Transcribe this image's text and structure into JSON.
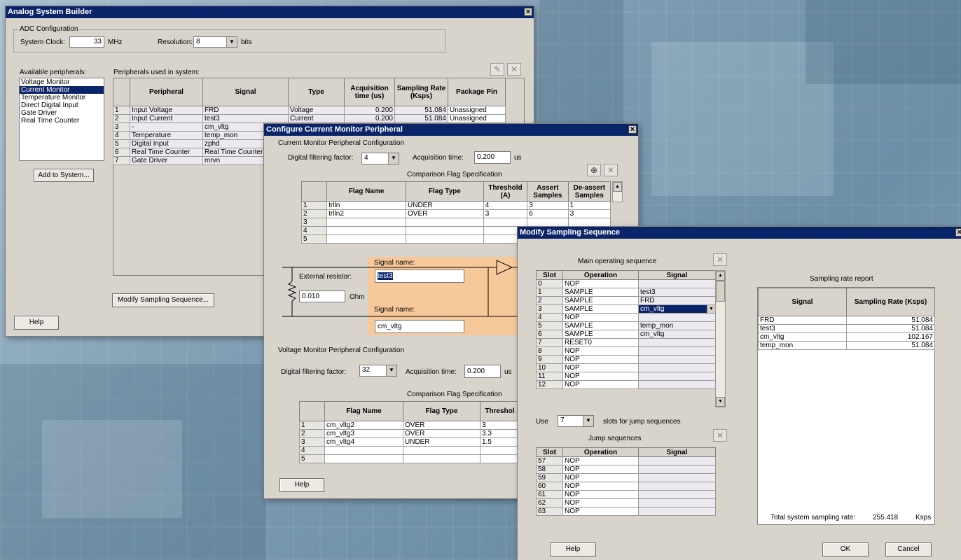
{
  "asb": {
    "title": "Analog System Builder",
    "adc_group": "ADC Configuration",
    "system_clock_label": "System Clock:",
    "system_clock_value": "33",
    "mhz": "MHz",
    "resolution_label": "Resolution:",
    "resolution_value": "8",
    "bits": "bits",
    "available_label": "Available peripherals:",
    "available": [
      "Voltage Monitor",
      "Current Monitor",
      "Temperature Monitor",
      "Direct Digital Input",
      "Gate Driver",
      "Real Time Counter"
    ],
    "used_label": "Peripherals used in system:",
    "headers": [
      "Peripheral",
      "Signal",
      "Type",
      "Acquisition time (us)",
      "Sampling Rate (Ksps)",
      "Package Pin"
    ],
    "rows": [
      [
        "1",
        "Input Voltage",
        "FRD",
        "Voltage",
        "0.200",
        "51.084",
        "Unassigned"
      ],
      [
        "2",
        "Input Current",
        "test3",
        "Current",
        "0.200",
        "51.084",
        "Unassigned"
      ],
      [
        "3",
        "-",
        "cm_vltg",
        "",
        "",
        "",
        ""
      ],
      [
        "4",
        "Temperature",
        "temp_mon",
        "",
        "",
        "",
        ""
      ],
      [
        "5",
        "Digital Input",
        "zphd",
        "",
        "",
        "",
        ""
      ],
      [
        "6",
        "Real Time Counter",
        "Real Time Counter",
        "",
        "",
        "",
        ""
      ],
      [
        "7",
        "Gate Driver",
        "mrvn",
        "",
        "",
        "",
        ""
      ]
    ],
    "add_button": "Add to System...",
    "modify_button": "Modify Sampling Sequence...",
    "help_button": "Help"
  },
  "ccm": {
    "title": "Configure Current Monitor Peripheral",
    "section1": "Current Monitor Peripheral Configuration",
    "dff_label": "Digital filtering factor:",
    "dff_value": "4",
    "acq_label": "Acquisition time:",
    "acq_value": "0.200",
    "us": "us",
    "cfs_label": "Comparison Flag Specification",
    "flag_headers": [
      "Flag Name",
      "Flag Type",
      "Threshold (A)",
      "Assert Samples",
      "De-assert Samples"
    ],
    "flags": [
      [
        "1",
        "trlln",
        "UNDER",
        "4",
        "3",
        "1"
      ],
      [
        "2",
        "trlln2",
        "OVER",
        "3",
        "6",
        "3"
      ],
      [
        "3",
        "",
        "",
        "",
        "",
        ""
      ],
      [
        "4",
        "",
        "",
        "",
        "",
        ""
      ],
      [
        "5",
        "",
        "",
        "",
        "",
        ""
      ]
    ],
    "ext_res_label": "External resistor:",
    "ext_res_value": "0.010",
    "ohm": "Ohm",
    "signal_name_label": "Signal name:",
    "signal1_value": "test3",
    "signal2_label": "Signal name:",
    "signal2_value": "cm_vltg",
    "section2": "Voltage Monitor Peripheral Configuration",
    "dff2_label": "Digital filtering factor:",
    "dff2_value": "32",
    "acq2_label": "Acquisition time:",
    "acq2_value": "0.200",
    "us2": "us",
    "cfs2_label": "Comparison Flag Specification",
    "vflag_headers": [
      "Flag Name",
      "Flag Type",
      "Threshol (V)"
    ],
    "vflags": [
      [
        "1",
        "cm_vltg2",
        "OVER",
        "3"
      ],
      [
        "2",
        "cm_vltg3",
        "OVER",
        "3.3"
      ],
      [
        "3",
        "cm_vltg4",
        "UNDER",
        "1.5"
      ],
      [
        "4",
        "",
        "",
        ""
      ],
      [
        "5",
        "",
        "",
        ""
      ]
    ],
    "help_button": "Help"
  },
  "mss": {
    "title": "Modify Sampling Sequence",
    "main_label": "Main operating sequence",
    "seq_headers": [
      "Slot",
      "Operation",
      "Signal"
    ],
    "main_rows": [
      [
        "0",
        "NOP",
        ""
      ],
      [
        "1",
        "SAMPLE",
        "test3"
      ],
      [
        "2",
        "SAMPLE",
        "FRD"
      ],
      [
        "3",
        "SAMPLE",
        "cm_vltg"
      ],
      [
        "4",
        "NOP",
        ""
      ],
      [
        "5",
        "SAMPLE",
        "temp_mon"
      ],
      [
        "6",
        "SAMPLE",
        "cm_vltg"
      ],
      [
        "7",
        "RESET0",
        ""
      ],
      [
        "8",
        "NOP",
        ""
      ],
      [
        "9",
        "NOP",
        ""
      ],
      [
        "10",
        "NOP",
        ""
      ],
      [
        "11",
        "NOP",
        ""
      ],
      [
        "12",
        "NOP",
        ""
      ]
    ],
    "use_label": "Use",
    "use_value": "7",
    "slots_label": "slots for jump sequences",
    "jump_label": "Jump sequences",
    "jump_rows": [
      [
        "57",
        "NOP",
        ""
      ],
      [
        "58",
        "NOP",
        ""
      ],
      [
        "59",
        "NOP",
        ""
      ],
      [
        "60",
        "NOP",
        ""
      ],
      [
        "61",
        "NOP",
        ""
      ],
      [
        "62",
        "NOP",
        ""
      ],
      [
        "63",
        "NOP",
        ""
      ]
    ],
    "report_label": "Sampling rate report",
    "report_headers": [
      "Signal",
      "Sampling Rate (Ksps)"
    ],
    "report_rows": [
      [
        "FRD",
        "51.084"
      ],
      [
        "test3",
        "51.084"
      ],
      [
        "cm_vltg",
        "102.167"
      ],
      [
        "temp_mon",
        "51.084"
      ]
    ],
    "total_label": "Total system sampling rate:",
    "total_value": "255.418",
    "ksps": "Ksps",
    "help_button": "Help",
    "ok_button": "OK",
    "cancel_button": "Cancel"
  },
  "icons": {
    "close": "×",
    "edit": "✎",
    "delete": "✕",
    "add": "⊕",
    "dropdown": "▼",
    "scroll_up": "▲",
    "scroll_down": "▼"
  }
}
